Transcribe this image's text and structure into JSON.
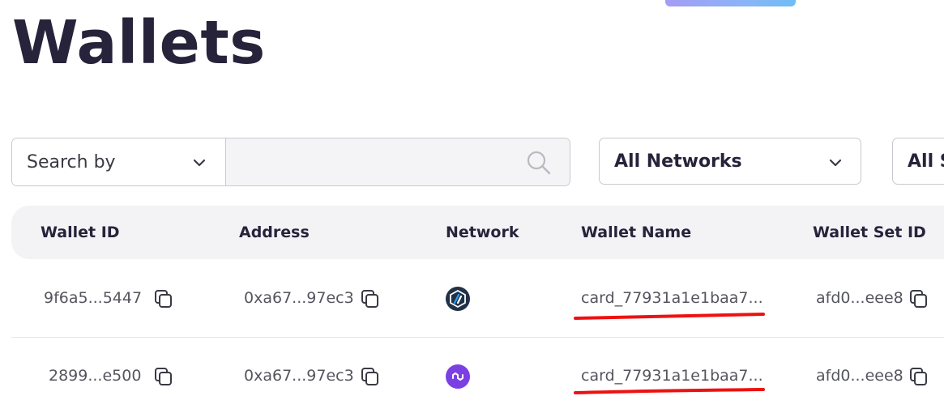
{
  "page": {
    "title": "Wallets"
  },
  "filters": {
    "search_by_label": "Search by",
    "search_placeholder": "",
    "network_select": "All Networks",
    "status_select": "All S"
  },
  "table": {
    "columns": [
      "Wallet ID",
      "Address",
      "Network",
      "Wallet Name",
      "Wallet Set ID"
    ],
    "rows": [
      {
        "wallet_id": "9f6a5...5447",
        "address": "0xa67...97ec3",
        "network_icon": "arbitrum-icon",
        "wallet_name": "card_77931a1e1baa7...",
        "wallet_set_id": "afd0...eee8"
      },
      {
        "wallet_id": "2899...e500",
        "address": "0xa67...97ec3",
        "network_icon": "polygon-icon",
        "wallet_name": "card_77931a1e1baa7...",
        "wallet_set_id": "afd0...eee8"
      }
    ]
  },
  "colors": {
    "title": "#26233a",
    "header_bg": "#f3f3f6",
    "annotation_underline": "#ee1111",
    "polygon": "#7b3fe4",
    "arbitrum_bg": "#213147"
  }
}
